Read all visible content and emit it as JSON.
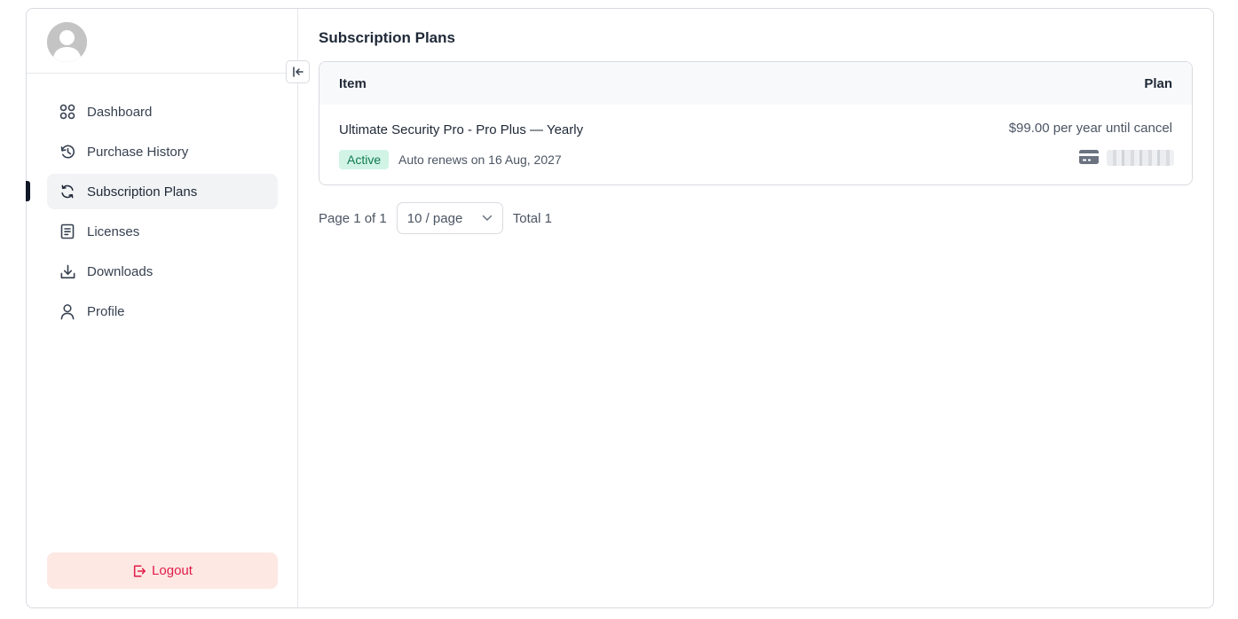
{
  "sidebar": {
    "avatar": "user-avatar",
    "collapse_icon": "collapse-left-icon",
    "items": [
      {
        "label": "Dashboard",
        "icon": "dashboard-icon",
        "active": false
      },
      {
        "label": "Purchase History",
        "icon": "history-icon",
        "active": false
      },
      {
        "label": "Subscription Plans",
        "icon": "refresh-icon",
        "active": true
      },
      {
        "label": "Licenses",
        "icon": "document-icon",
        "active": false
      },
      {
        "label": "Downloads",
        "icon": "download-icon",
        "active": false
      },
      {
        "label": "Profile",
        "icon": "user-icon",
        "active": false
      }
    ],
    "logout_label": "Logout"
  },
  "main": {
    "title": "Subscription Plans",
    "table": {
      "columns": [
        "Item",
        "Plan"
      ],
      "rows": [
        {
          "item": "Ultimate Security Pro - Pro Plus — Yearly",
          "status": "Active",
          "renewal": "Auto renews on 16 Aug, 2027",
          "plan": "$99.00 per year until cancel",
          "payment_icon": "credit-card-icon"
        }
      ]
    },
    "pagination": {
      "page_text": "Page 1 of 1",
      "page_size": "10 / page",
      "total": "Total 1"
    }
  },
  "colors": {
    "active_badge_bg": "#d1f4e6",
    "active_badge_text": "#0f7a4f",
    "logout_bg": "#fde8e4",
    "logout_text": "#e11d48",
    "active_nav_bg": "#f1f3f5"
  }
}
